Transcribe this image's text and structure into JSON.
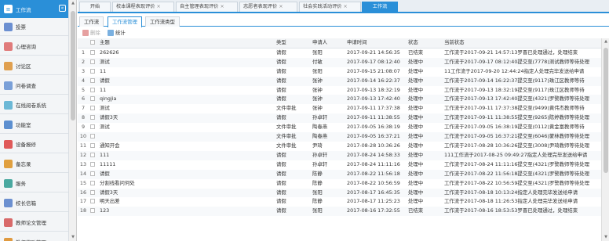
{
  "sidebar": {
    "active_label": "工作流",
    "collapse_glyph": "«",
    "items": [
      {
        "label": "投票",
        "color": "#6b8fd1"
      },
      {
        "label": "心理咨询",
        "color": "#e07b7b"
      },
      {
        "label": "讨论区",
        "color": "#e0a050"
      },
      {
        "label": "问卷调查",
        "color": "#7aa0d8"
      },
      {
        "label": "在线阅卷系统",
        "color": "#6cb8d6"
      },
      {
        "label": "功能室",
        "color": "#5c8fd0"
      },
      {
        "label": "设备报修",
        "color": "#e05a5a"
      },
      {
        "label": "备忘录",
        "color": "#e0a040"
      },
      {
        "label": "服务",
        "color": "#4aa8a0"
      },
      {
        "label": "校长信箱",
        "color": "#6c90d0"
      },
      {
        "label": "教师论文管理",
        "color": "#d86a6a"
      },
      {
        "label": "教师奖励管理",
        "color": "#e09a40"
      }
    ]
  },
  "top_tabs": [
    {
      "label": "开始",
      "closable": false
    },
    {
      "label": "校本课程表现评价",
      "closable": true
    },
    {
      "label": "自主管理表现评价",
      "closable": true
    },
    {
      "label": "志愿者表现评价",
      "closable": true
    },
    {
      "label": "社会实践活动评价",
      "closable": true
    },
    {
      "label": "工作流",
      "closable": false,
      "active": true
    }
  ],
  "close_glyph": "×",
  "sub_tabs": [
    "工作流",
    "工作流管理",
    "工作流类型"
  ],
  "toolbar": {
    "delete_label": "删除",
    "stats_label": "统计"
  },
  "grid": {
    "headers": [
      "",
      "主题",
      "类型",
      "申请人",
      "申请时间",
      "状态",
      "当前状态"
    ],
    "rows": [
      [
        "1",
        "262626",
        "请假",
        "张阳",
        "2017-09-21 14:56:35",
        "已结束",
        "工作流于2017-09-21 14:57:13罗晋已处理通过，处理结束"
      ],
      [
        "2",
        "测试",
        "请假",
        "付敏",
        "2017-09-17 08:12:40",
        "处理中",
        "工作流于2017-09-17 08:12:40提交至(7778)测试教师等待处理"
      ],
      [
        "3",
        "11",
        "请假",
        "张阳",
        "2017-09-15 21:08:07",
        "处理中",
        "11工作流于2017-09-20 12:44:24指定人处理完毕发送给申请"
      ],
      [
        "4",
        "请假",
        "请假",
        "张钟",
        "2017-09-14 16:22:37",
        "处理中",
        "工作流于2017-09-14 16:22:37提交至(9117)珠江区教师等待"
      ],
      [
        "5",
        "11",
        "请假",
        "张钟",
        "2017-09-13 18:32:19",
        "处理中",
        "工作流于2017-09-13 18:32:19提交至(9117)珠江区教师等待"
      ],
      [
        "6",
        "qingjia",
        "请假",
        "张钟",
        "2017-09-13 17:42:40",
        "处理中",
        "工作流于2017-09-13 17:42:40提交至(4321)罗警教师等待处理"
      ],
      [
        "7",
        "测试",
        "文件审批",
        "张钟",
        "2017-09-11 17:37:38",
        "处理中",
        "工作流于2017-09-11 17:37:38提交至(9499)黄伟杰教师等待"
      ],
      [
        "8",
        "请假3天",
        "请假",
        "孙卓轩",
        "2017-09-11 11:38:55",
        "处理中",
        "工作流于2017-09-11 11:38:55提交至(9265)陈婷教师等待处理"
      ],
      [
        "9",
        "测试",
        "文件审批",
        "陶春燕",
        "2017-09-05 16:38:19",
        "处理中",
        "工作流于2017-09-05 16:38:19提交至(0112)黄金富教师等待"
      ],
      [
        "10",
        "",
        "文件审批",
        "陶春燕",
        "2017-09-05 16:37:21",
        "处理中",
        "工作流于2017-09-05 16:37:21提交至(6046)蒙林教师等待处理"
      ],
      [
        "11",
        "通知开会",
        "文件审批",
        "尹琦",
        "2017-08-28 10:36:26",
        "处理中",
        "工作流于2017-08-28 10:36:26提交至(3008)尹琦教师等待处理"
      ],
      [
        "12",
        "111",
        "请假",
        "孙卓轩",
        "2017-08-24 14:58:33",
        "处理中",
        "111工作流于2017-08-25 09:49:27指定人处理完毕发送给申请"
      ],
      [
        "13",
        "11111",
        "请假",
        "孙卓轩",
        "2017-08-24 11:11:16",
        "处理中",
        "工作流于2017-08-24 11:11:16提交至(4321)罗警教师等待处理"
      ],
      [
        "14",
        "请假",
        "请假",
        "陈静",
        "2017-08-22 11:56:18",
        "处理中",
        "工作流于2017-08-22 11:56:18提交至(4321)罗警教师等待处理"
      ],
      [
        "15",
        "分割线看问何处",
        "请假",
        "陈静",
        "2017-08-22 10:56:59",
        "处理中",
        "工作流于2017-08-22 10:56:59提交至(4321)罗警教师等待处理"
      ],
      [
        "16",
        "请假3天",
        "请假",
        "张阳",
        "2017-08-17 16:45:35",
        "处理中",
        "工作流于2017-08-18 10:13:24指定人处理完毕发送给申请"
      ],
      [
        "17",
        "明天出差",
        "请假",
        "陈静",
        "2017-08-17 11:25:23",
        "处理中",
        "工作流于2017-08-18 11:26:53指定人处理完毕发送给申请"
      ],
      [
        "18",
        "123",
        "请假",
        "张阳",
        "2017-08-16 17:32:55",
        "已结束",
        "工作流于2017-08-16 18:53:53罗晋已处理通过，处理结束"
      ]
    ]
  }
}
